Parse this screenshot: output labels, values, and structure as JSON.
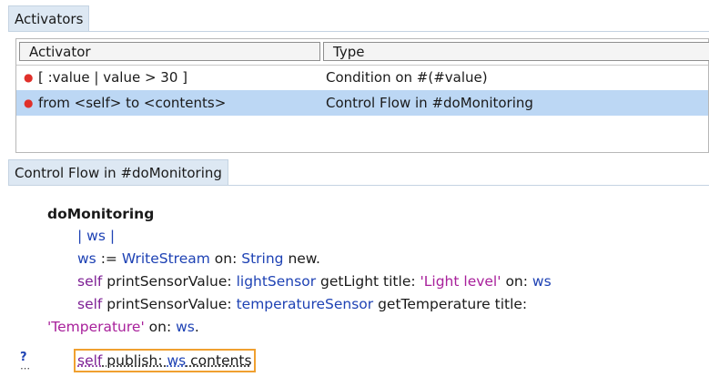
{
  "activators_tab": {
    "label": "Activators"
  },
  "table": {
    "headers": [
      "Activator",
      "Type"
    ],
    "rows": [
      {
        "activator": "[ :value | value > 30 ]",
        "type": "Condition on #(#value)",
        "selected": false
      },
      {
        "activator": "from <self> to <contents>",
        "type": "Control Flow in #doMonitoring",
        "selected": true
      }
    ]
  },
  "source_tab": {
    "label": "Control Flow in #doMonitoring"
  },
  "code": {
    "method_name": "doMonitoring",
    "l1": {
      "bar_open": "| ",
      "var": "ws",
      "bar_close": " |"
    },
    "l2": {
      "var": "ws",
      "assign": " := ",
      "cls": "WriteStream",
      "sel": " on: ",
      "cls2": "String",
      "msg": " new."
    },
    "l3": {
      "kw": "self",
      "sel1": " printSensorValue: ",
      "var": "lightSensor",
      "msg1": " getLight title: ",
      "str": "'Light level'",
      "msg2": " on: ",
      "var2": "ws"
    },
    "l4": {
      "kw": "self",
      "sel1": " printSensorValue: ",
      "var": "temperatureSensor",
      "msg1": " getTemperature title:"
    },
    "l5": {
      "str": "'Temperature'",
      "sel": " on: ",
      "var": "ws",
      "end": "."
    },
    "l6": {
      "kw": "self",
      "sel": " publish: ",
      "var": "ws",
      "msg": " contents"
    },
    "gutter_glyph": "?",
    "gutter_dots": "⋯"
  },
  "colors": {
    "selection": "#bcd7f4",
    "tab": "#dde8f3",
    "highlight_border": "#f0a030",
    "bullet": "#e0302a"
  }
}
